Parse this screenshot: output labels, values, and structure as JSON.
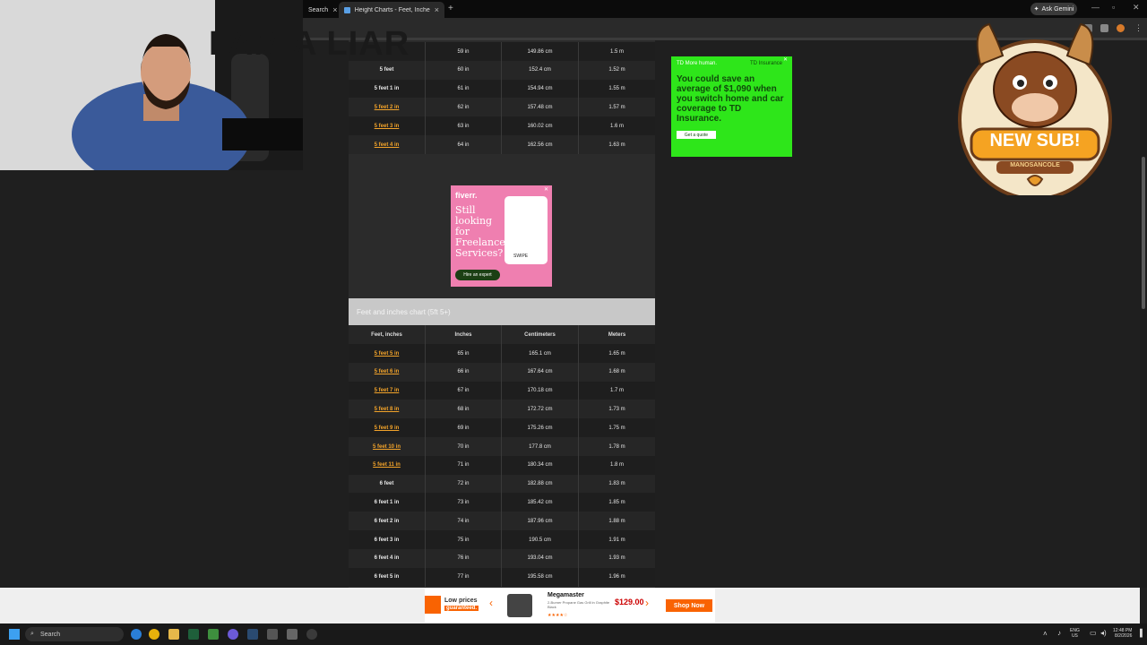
{
  "browser": {
    "tabs": [
      {
        "label": "Search"
      },
      {
        "label": "Height Charts - Feet, Inches, Ce"
      }
    ],
    "new_tab": "+",
    "ask_gemini": "Ask Gemini"
  },
  "overlay": {
    "caption": "I AM A LIAR",
    "badge_title": "NEW SUB!",
    "badge_name": "MANOSANCOLE"
  },
  "table_top": {
    "rows": [
      {
        "feet": "",
        "inches": "59 in",
        "cm": "149.86 cm",
        "m": "1.5 m",
        "link": false
      },
      {
        "feet": "5 feet",
        "inches": "60 in",
        "cm": "152.4 cm",
        "m": "1.52 m",
        "link": false
      },
      {
        "feet": "5 feet 1 in",
        "inches": "61 in",
        "cm": "154.94 cm",
        "m": "1.55 m",
        "link": false
      },
      {
        "feet": "5 feet 2 in",
        "inches": "62 in",
        "cm": "157.48 cm",
        "m": "1.57 m",
        "link": true
      },
      {
        "feet": "5 feet 3 in",
        "inches": "63 in",
        "cm": "160.02 cm",
        "m": "1.6 m",
        "link": true
      },
      {
        "feet": "5 feet 4 in",
        "inches": "64 in",
        "cm": "162.56 cm",
        "m": "1.63 m",
        "link": true
      }
    ]
  },
  "section": {
    "title": "Feet and inches chart (5ft 5+)"
  },
  "table_main": {
    "headers": [
      "Feet, inches",
      "Inches",
      "Centimeters",
      "Meters"
    ],
    "rows": [
      {
        "feet": "5 feet 5 in",
        "inches": "65 in",
        "cm": "165.1 cm",
        "m": "1.65 m",
        "link": true
      },
      {
        "feet": "5 feet 6 in",
        "inches": "66 in",
        "cm": "167.64 cm",
        "m": "1.68 m",
        "link": true
      },
      {
        "feet": "5 feet 7 in",
        "inches": "67 in",
        "cm": "170.18 cm",
        "m": "1.7 m",
        "link": true
      },
      {
        "feet": "5 feet 8 in",
        "inches": "68 in",
        "cm": "172.72 cm",
        "m": "1.73 m",
        "link": true
      },
      {
        "feet": "5 feet 9 in",
        "inches": "69 in",
        "cm": "175.26 cm",
        "m": "1.75 m",
        "link": true
      },
      {
        "feet": "5 feet 10 in",
        "inches": "70 in",
        "cm": "177.8 cm",
        "m": "1.78 m",
        "link": true
      },
      {
        "feet": "5 feet 11 in",
        "inches": "71 in",
        "cm": "180.34 cm",
        "m": "1.8 m",
        "link": true
      },
      {
        "feet": "6 feet",
        "inches": "72 in",
        "cm": "182.88 cm",
        "m": "1.83 m",
        "link": false
      },
      {
        "feet": "6 feet 1 in",
        "inches": "73 in",
        "cm": "185.42 cm",
        "m": "1.85 m",
        "link": false
      },
      {
        "feet": "6 feet 2 in",
        "inches": "74 in",
        "cm": "187.96 cm",
        "m": "1.88 m",
        "link": false
      },
      {
        "feet": "6 feet 3 in",
        "inches": "75 in",
        "cm": "190.5 cm",
        "m": "1.91 m",
        "link": false
      },
      {
        "feet": "6 feet 4 in",
        "inches": "76 in",
        "cm": "193.04 cm",
        "m": "1.93 m",
        "link": false
      },
      {
        "feet": "6 feet 5 in",
        "inches": "77 in",
        "cm": "195.58 cm",
        "m": "1.96 m",
        "link": false
      }
    ]
  },
  "ads": {
    "fiverr": {
      "logo": "fiverr.",
      "headline": "Still looking for Freelance Services?",
      "swipe": "SWIPE",
      "cta": "Hire an expert"
    },
    "td": {
      "tag": "TD More human.",
      "brand": "TD Insurance",
      "headline": "You could save an average of $1,090 when you switch home and car coverage to TD Insurance.",
      "cta": "Get a quote"
    },
    "home_depot": {
      "tagline": "Low prices",
      "tagline2": "guaranteed.",
      "product": "Megamaster",
      "description": "2-Burner Propane Gas Grill in Graphite Black",
      "price": "$129.00",
      "cta": "Shop Now"
    }
  },
  "taskbar": {
    "search": "Search",
    "lang": "ENG",
    "region": "US",
    "time": "12:48 PM",
    "date": "8/2/2026"
  }
}
